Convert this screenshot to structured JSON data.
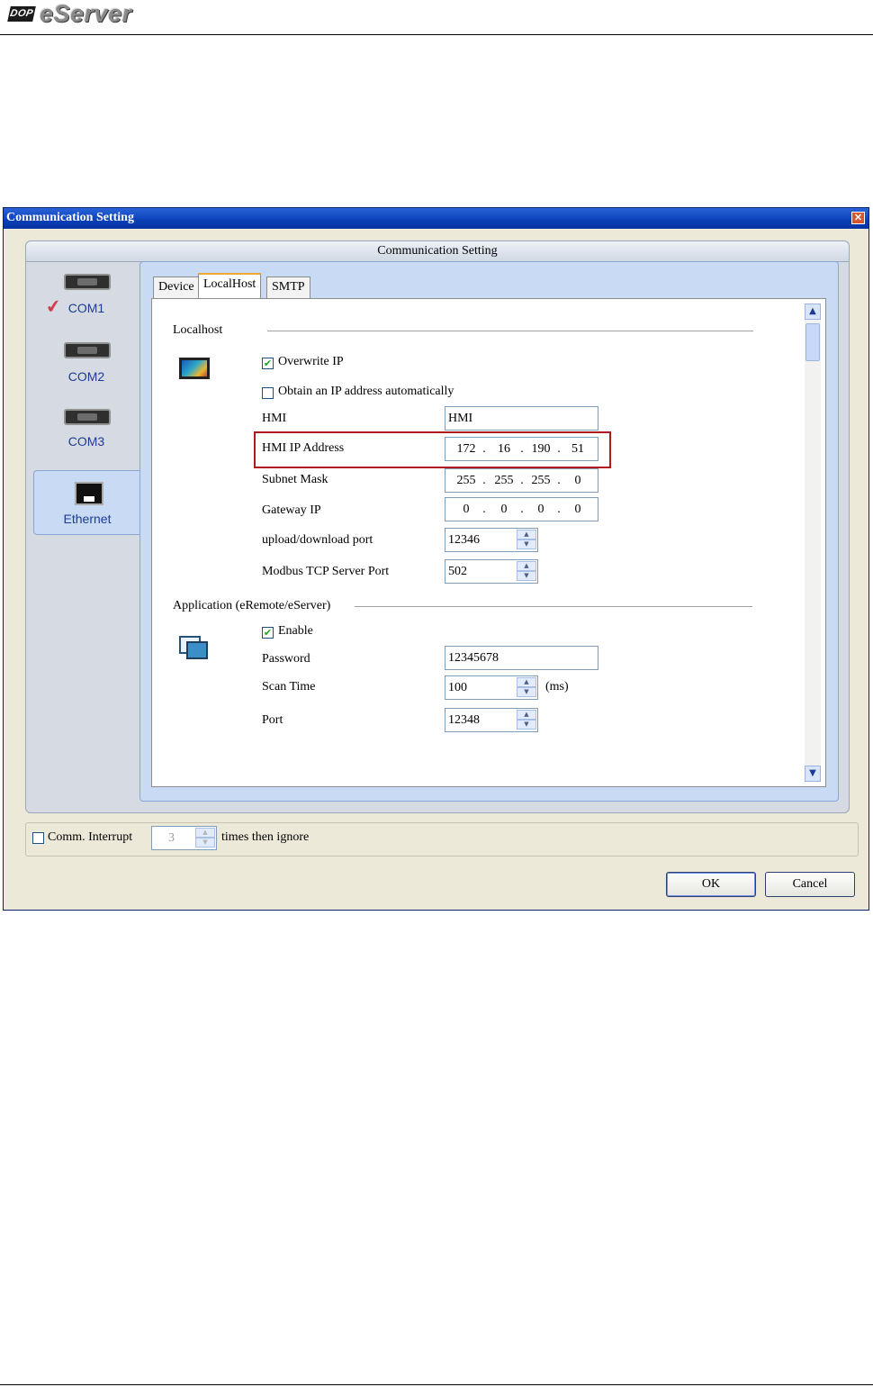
{
  "page": {
    "logo_badge": "DOP",
    "logo_text": "eServer"
  },
  "window": {
    "title": "Communication Setting",
    "close_glyph": "✕"
  },
  "panel": {
    "title": "Communication Setting"
  },
  "nav": {
    "items": [
      {
        "label": "COM1",
        "icon": "serial-port-icon",
        "checked": true
      },
      {
        "label": "COM2",
        "icon": "serial-port-icon",
        "checked": false
      },
      {
        "label": "COM3",
        "icon": "serial-port-icon",
        "checked": false
      },
      {
        "label": "Ethernet",
        "icon": "ethernet-port-icon",
        "selected": true
      }
    ],
    "check_glyph": "✔"
  },
  "tabs": [
    {
      "label": "Device",
      "active": false
    },
    {
      "label": "LocalHost",
      "active": true
    },
    {
      "label": "SMTP",
      "active": false
    }
  ],
  "localhost": {
    "group_title": "Localhost",
    "overwrite_ip": {
      "label": "Overwrite IP",
      "checked": true
    },
    "obtain_auto": {
      "label": "Obtain an IP address automatically",
      "checked": false
    },
    "hmi": {
      "label": "HMI",
      "value": "HMI"
    },
    "hmi_ip": {
      "label": "HMI IP Address",
      "octets": [
        "172",
        "16",
        "190",
        "51"
      ]
    },
    "subnet": {
      "label": "Subnet Mask",
      "octets": [
        "255",
        "255",
        "255",
        "0"
      ]
    },
    "gateway": {
      "label": "Gateway IP",
      "octets": [
        "0",
        "0",
        "0",
        "0"
      ]
    },
    "upload_port": {
      "label": "upload/download port",
      "value": "12346"
    },
    "modbus_port": {
      "label": "Modbus TCP  Server Port",
      "value": "502"
    }
  },
  "application": {
    "group_title": "Application (eRemote/eServer)",
    "enable": {
      "label": "Enable",
      "checked": true
    },
    "password": {
      "label": "Password",
      "value": "12345678"
    },
    "scan_time": {
      "label": "Scan Time",
      "value": "100",
      "unit": "(ms)"
    },
    "port": {
      "label": "Port",
      "value": "12348"
    }
  },
  "bottom": {
    "comm_interrupt": {
      "label": "Comm. Interrupt",
      "checked": false
    },
    "times_value": "3",
    "times_label": "times then ignore",
    "ok_label": "OK",
    "cancel_label": "Cancel"
  },
  "glyphs": {
    "check": "✔",
    "up": "▲",
    "down": "▼",
    "scroll_up": "▲",
    "scroll_down": "▼",
    "dot": "."
  },
  "colors": {
    "titlebar": "#0a3fb8",
    "highlight": "#b0191d",
    "nav_selected": "#c9daf5"
  }
}
